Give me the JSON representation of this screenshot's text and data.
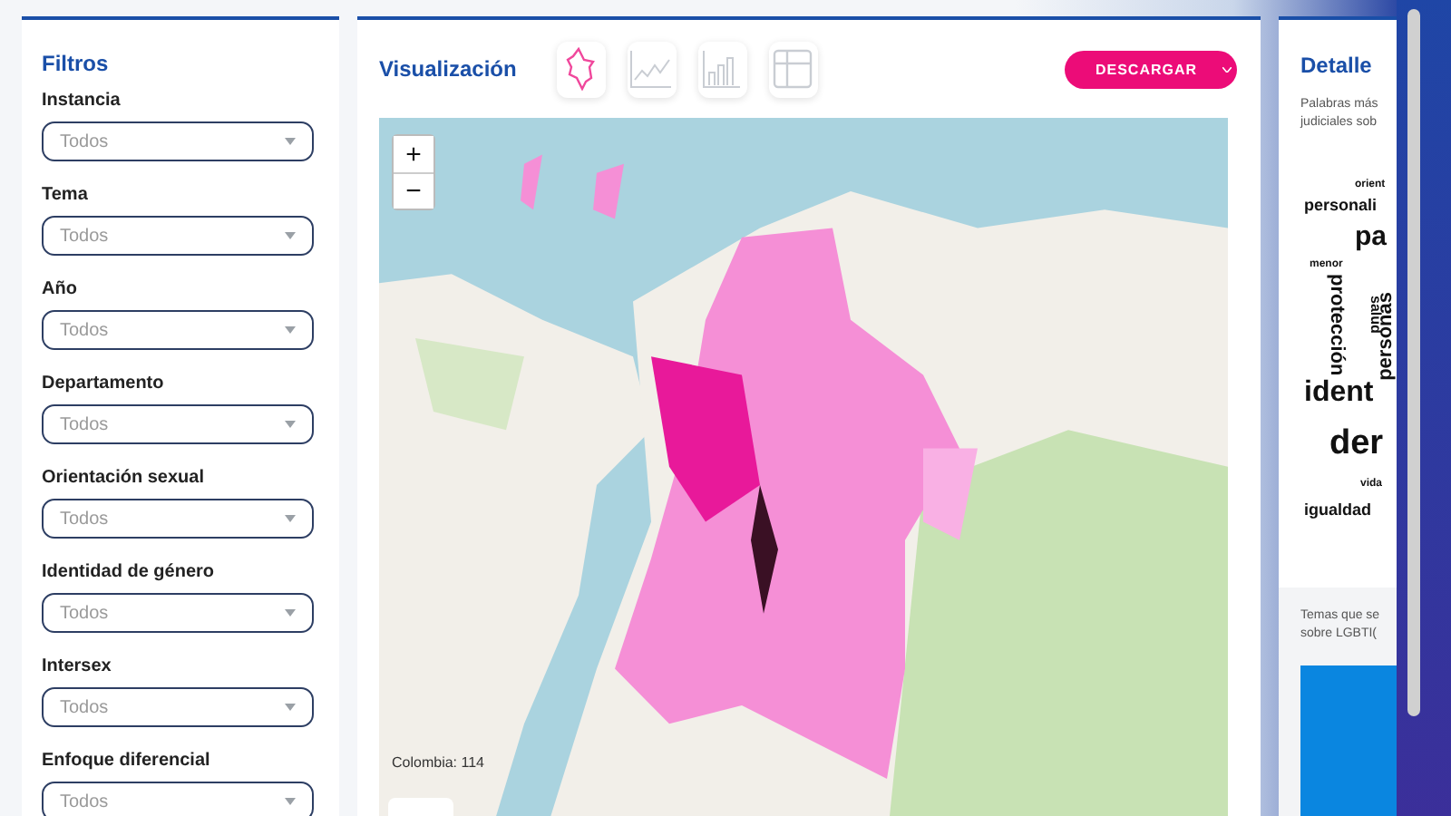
{
  "filters_panel": {
    "title": "Filtros",
    "filters": [
      {
        "label": "Instancia",
        "placeholder": "Todos"
      },
      {
        "label": "Tema",
        "placeholder": "Todos"
      },
      {
        "label": "Año",
        "placeholder": "Todos"
      },
      {
        "label": "Departamento",
        "placeholder": "Todos"
      },
      {
        "label": "Orientación sexual",
        "placeholder": "Todos"
      },
      {
        "label": "Identidad de género",
        "placeholder": "Todos"
      },
      {
        "label": "Intersex",
        "placeholder": "Todos"
      },
      {
        "label": "Enfoque diferencial",
        "placeholder": "Todos"
      }
    ]
  },
  "visualization": {
    "title": "Visualización",
    "view_buttons": [
      {
        "kind": "map",
        "selected": true
      },
      {
        "kind": "line",
        "selected": false
      },
      {
        "kind": "bar",
        "selected": false
      },
      {
        "kind": "table",
        "selected": false
      }
    ],
    "download_button": "DESCARGAR",
    "map": {
      "kind": "picture",
      "zoom_in": "+",
      "zoom_out": "−",
      "total_label": "Colombia: 114"
    }
  },
  "detail": {
    "title": "Detalle",
    "description_lines": [
      "Palabras más",
      "judiciales sob"
    ],
    "word_cloud": [
      {
        "text": "orient",
        "kind": "horizontal"
      },
      {
        "text": "personali",
        "kind": "horizontal"
      },
      {
        "text": "pa",
        "kind": "horizontal"
      },
      {
        "text": "menor",
        "kind": "horizontal"
      },
      {
        "text": "protección",
        "kind": "vertical"
      },
      {
        "text": "salud",
        "kind": "vertical"
      },
      {
        "text": "personas",
        "kind": "flipped"
      },
      {
        "text": "ident",
        "kind": "horizontal"
      },
      {
        "text": "der",
        "kind": "horizontal"
      },
      {
        "text": "vida",
        "kind": "horizontal"
      },
      {
        "text": "igualdad",
        "kind": "horizontal"
      }
    ],
    "topics_lines": [
      "Temas que se",
      "sobre LGBTI("
    ]
  }
}
